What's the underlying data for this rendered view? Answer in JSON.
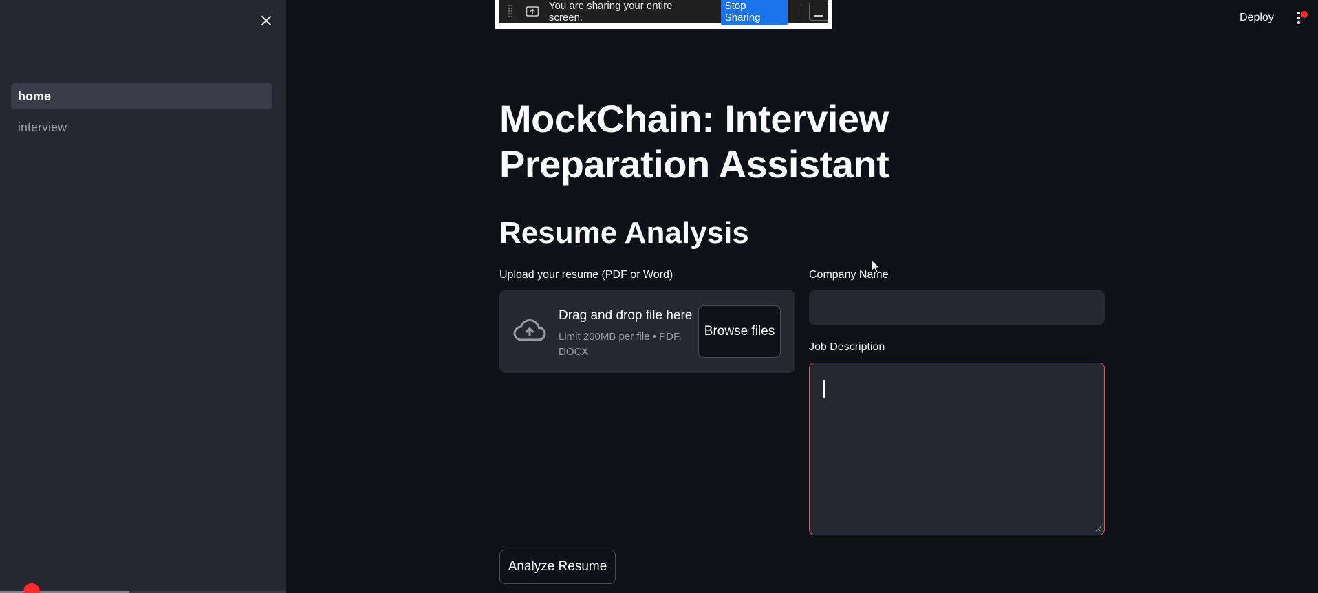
{
  "sidebar": {
    "items": [
      {
        "label": "home",
        "active": true
      },
      {
        "label": "interview",
        "active": false
      }
    ]
  },
  "screen_share": {
    "message": "You are sharing your entire screen.",
    "stop_label": "Stop Sharing"
  },
  "header": {
    "deploy_label": "Deploy"
  },
  "main": {
    "title": "MockChain: Interview Preparation Assistant",
    "subtitle": "Resume Analysis",
    "upload": {
      "label": "Upload your resume (PDF or Word)",
      "drop_text": "Drag and drop file here",
      "limit_text": "Limit 200MB per file • PDF, DOCX",
      "browse_label": "Browse files"
    },
    "company": {
      "label": "Company Name",
      "value": ""
    },
    "job_description": {
      "label": "Job Description",
      "value": ""
    },
    "analyze_label": "Analyze Resume"
  },
  "colors": {
    "background": "#0e1117",
    "sidebar": "#262730",
    "accent": "#ff4b4b",
    "share_button": "#1a73e8"
  },
  "icons": [
    "close-icon",
    "share-screen-icon",
    "cloud-upload-icon",
    "more-vertical-icon",
    "resize-grip-icon",
    "mouse-cursor-icon"
  ]
}
